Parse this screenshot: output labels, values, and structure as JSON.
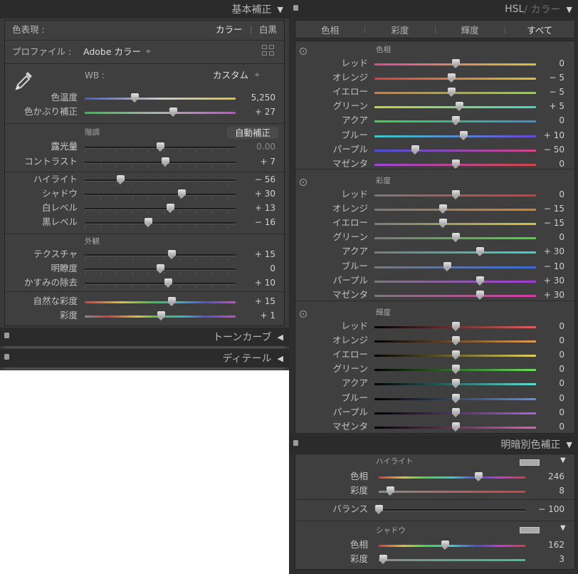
{
  "basic_panel": {
    "title": "基本補正",
    "color_mode": {
      "label": "色表現 :",
      "color": "カラー",
      "bw": "白黒"
    },
    "profile": {
      "label": "プロファイル :",
      "value": "Adobe カラー",
      "chev": "÷"
    },
    "wb": {
      "label": "WB :",
      "value": "カスタム",
      "chev": "÷"
    },
    "sliders_wb": [
      {
        "label": "色温度",
        "value": "5,250",
        "pos": 0.33
      },
      {
        "label": "色かぶり補正",
        "value": "+ 27",
        "pos": 0.585
      }
    ],
    "tone_section": {
      "title": "階調",
      "auto_label": "自動補正"
    },
    "sliders_tone": [
      {
        "label": "露光量",
        "value": "0.00",
        "pos": 0.5,
        "dim": true
      },
      {
        "label": "コントラスト",
        "value": "+ 7",
        "pos": 0.535
      }
    ],
    "sliders_tone2": [
      {
        "label": "ハイライト",
        "value": "− 56",
        "pos": 0.235
      },
      {
        "label": "シャドウ",
        "value": "+ 30",
        "pos": 0.64
      },
      {
        "label": "白レベル",
        "value": "+ 13",
        "pos": 0.565
      },
      {
        "label": "黒レベル",
        "value": "− 16",
        "pos": 0.42
      }
    ],
    "presence_section": {
      "title": "外観"
    },
    "sliders_presence": [
      {
        "label": "テクスチャ",
        "value": "+ 15",
        "pos": 0.575
      },
      {
        "label": "明瞭度",
        "value": "0",
        "pos": 0.5
      },
      {
        "label": "かすみの除去",
        "value": "+ 10",
        "pos": 0.55
      }
    ],
    "sliders_vibrance": [
      {
        "label": "自然な彩度",
        "value": "+ 15",
        "pos": 0.575
      },
      {
        "label": "彩度",
        "value": "+ 1",
        "pos": 0.505
      }
    ]
  },
  "tone_curve_panel": {
    "title": "トーンカーブ"
  },
  "detail_panel": {
    "title": "ディテール"
  },
  "hsl_panel": {
    "title": "HSL",
    "title_dim": " / カラー",
    "tabs": [
      "色相",
      "彩度",
      "輝度",
      "すべて"
    ],
    "hue": {
      "title": "色相",
      "rows": [
        {
          "label": "レッド",
          "value": "0",
          "pos": 0.5,
          "grad": [
            "#d94a9a",
            "#d6c43a"
          ]
        },
        {
          "label": "オレンジ",
          "value": "− 5",
          "pos": 0.475,
          "grad": [
            "#d64040",
            "#d6c43a"
          ]
        },
        {
          "label": "イエロー",
          "value": "− 5",
          "pos": 0.475,
          "grad": [
            "#d67a35",
            "#8ed63a"
          ]
        },
        {
          "label": "グリーン",
          "value": "+ 5",
          "pos": 0.525,
          "grad": [
            "#c8d03a",
            "#3fd6c8"
          ]
        },
        {
          "label": "アクア",
          "value": "0",
          "pos": 0.5,
          "grad": [
            "#3bd64b",
            "#3b8ed6"
          ]
        },
        {
          "label": "ブルー",
          "value": "+ 10",
          "pos": 0.55,
          "grad": [
            "#3fc9c9",
            "#6b45d6"
          ]
        },
        {
          "label": "パープル",
          "value": "− 50",
          "pos": 0.25,
          "grad": [
            "#4750d6",
            "#d6438a"
          ]
        },
        {
          "label": "マゼンタ",
          "value": "0",
          "pos": 0.5,
          "grad": [
            "#9c47d6",
            "#d64545"
          ]
        }
      ]
    },
    "saturation": {
      "title": "彩度",
      "rows": [
        {
          "label": "レッド",
          "value": "0",
          "pos": 0.5,
          "grad": [
            "#7a7a7a",
            "#d63a3a"
          ]
        },
        {
          "label": "オレンジ",
          "value": "− 15",
          "pos": 0.425,
          "grad": [
            "#7a7a7a",
            "#d6832f"
          ]
        },
        {
          "label": "イエロー",
          "value": "− 15",
          "pos": 0.425,
          "grad": [
            "#7a7a7a",
            "#d6c43a"
          ]
        },
        {
          "label": "グリーン",
          "value": "0",
          "pos": 0.5,
          "grad": [
            "#7a7a7a",
            "#4ad63a"
          ]
        },
        {
          "label": "アクア",
          "value": "+ 30",
          "pos": 0.65,
          "grad": [
            "#7a7a7a",
            "#3ad6c8"
          ]
        },
        {
          "label": "ブルー",
          "value": "− 10",
          "pos": 0.45,
          "grad": [
            "#7a7a7a",
            "#3a6ad6"
          ]
        },
        {
          "label": "パープル",
          "value": "+ 30",
          "pos": 0.65,
          "grad": [
            "#7a7a7a",
            "#a43ad6"
          ]
        },
        {
          "label": "マゼンタ",
          "value": "+ 30",
          "pos": 0.65,
          "grad": [
            "#7a7a7a",
            "#d63aa6"
          ]
        }
      ]
    },
    "luminance": {
      "title": "輝度",
      "rows": [
        {
          "label": "レッド",
          "value": "0",
          "pos": 0.5,
          "grad": [
            "#000000",
            "#e06060"
          ]
        },
        {
          "label": "オレンジ",
          "value": "0",
          "pos": 0.5,
          "grad": [
            "#000000",
            "#e09a55"
          ]
        },
        {
          "label": "イエロー",
          "value": "0",
          "pos": 0.5,
          "grad": [
            "#000000",
            "#e0d060"
          ]
        },
        {
          "label": "グリーン",
          "value": "0",
          "pos": 0.5,
          "grad": [
            "#000000",
            "#6ae060"
          ]
        },
        {
          "label": "アクア",
          "value": "0",
          "pos": 0.5,
          "grad": [
            "#000000",
            "#60e0d4"
          ]
        },
        {
          "label": "ブルー",
          "value": "0",
          "pos": 0.5,
          "grad": [
            "#000000",
            "#6090e0"
          ]
        },
        {
          "label": "パープル",
          "value": "0",
          "pos": 0.5,
          "grad": [
            "#000000",
            "#b060e0"
          ]
        },
        {
          "label": "マゼンタ",
          "value": "0",
          "pos": 0.5,
          "grad": [
            "#000000",
            "#e060b8"
          ]
        }
      ]
    }
  },
  "split_panel": {
    "title": "明暗別色補正",
    "highlight": {
      "title": "ハイライト",
      "rows": [
        {
          "label": "色相",
          "value": "246",
          "pos": 0.68,
          "kind": "hue"
        },
        {
          "label": "彩度",
          "value": "8",
          "pos": 0.08,
          "kind": "sat-red"
        }
      ]
    },
    "balance": {
      "label": "バランス",
      "value": "− 100",
      "pos": 0.0
    },
    "shadow": {
      "title": "シャドウ",
      "rows": [
        {
          "label": "色相",
          "value": "162",
          "pos": 0.45,
          "kind": "hue"
        },
        {
          "label": "彩度",
          "value": "3",
          "pos": 0.03,
          "kind": "sat-green"
        }
      ]
    }
  }
}
